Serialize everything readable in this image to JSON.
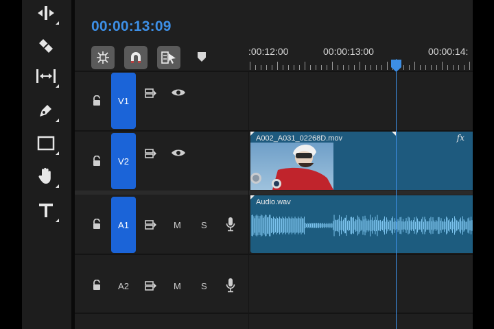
{
  "timecode": "00:00:13:09",
  "ruler": {
    "labels": [
      ":00:12:00",
      "00:00:13:00",
      "00:00:14:"
    ]
  },
  "tools": [
    {
      "name": "move-tool",
      "icon": "ripple-edit-icon"
    },
    {
      "name": "razor-tool",
      "icon": "razor-icon"
    },
    {
      "name": "slip-tool",
      "icon": "slip-icon"
    },
    {
      "name": "pen-tool",
      "icon": "pen-icon"
    },
    {
      "name": "rectangle-tool",
      "icon": "rectangle-icon"
    },
    {
      "name": "hand-tool",
      "icon": "hand-icon"
    },
    {
      "name": "type-tool",
      "icon": "type-icon"
    }
  ],
  "tracks": {
    "v1": {
      "label": "V1"
    },
    "v2": {
      "label": "V2"
    },
    "a1": {
      "label": "A1",
      "mute": "M",
      "solo": "S"
    },
    "a2": {
      "label": "A2",
      "mute": "M",
      "solo": "S"
    }
  },
  "clips": {
    "video": {
      "name": "A002_A031_02268D.mov",
      "fx": "fx"
    },
    "audio": {
      "name": "Audio.wav"
    }
  },
  "colors": {
    "accent": "#3d8fe6",
    "track_label": "#1b64d8",
    "clip": "#1e5a7e"
  }
}
